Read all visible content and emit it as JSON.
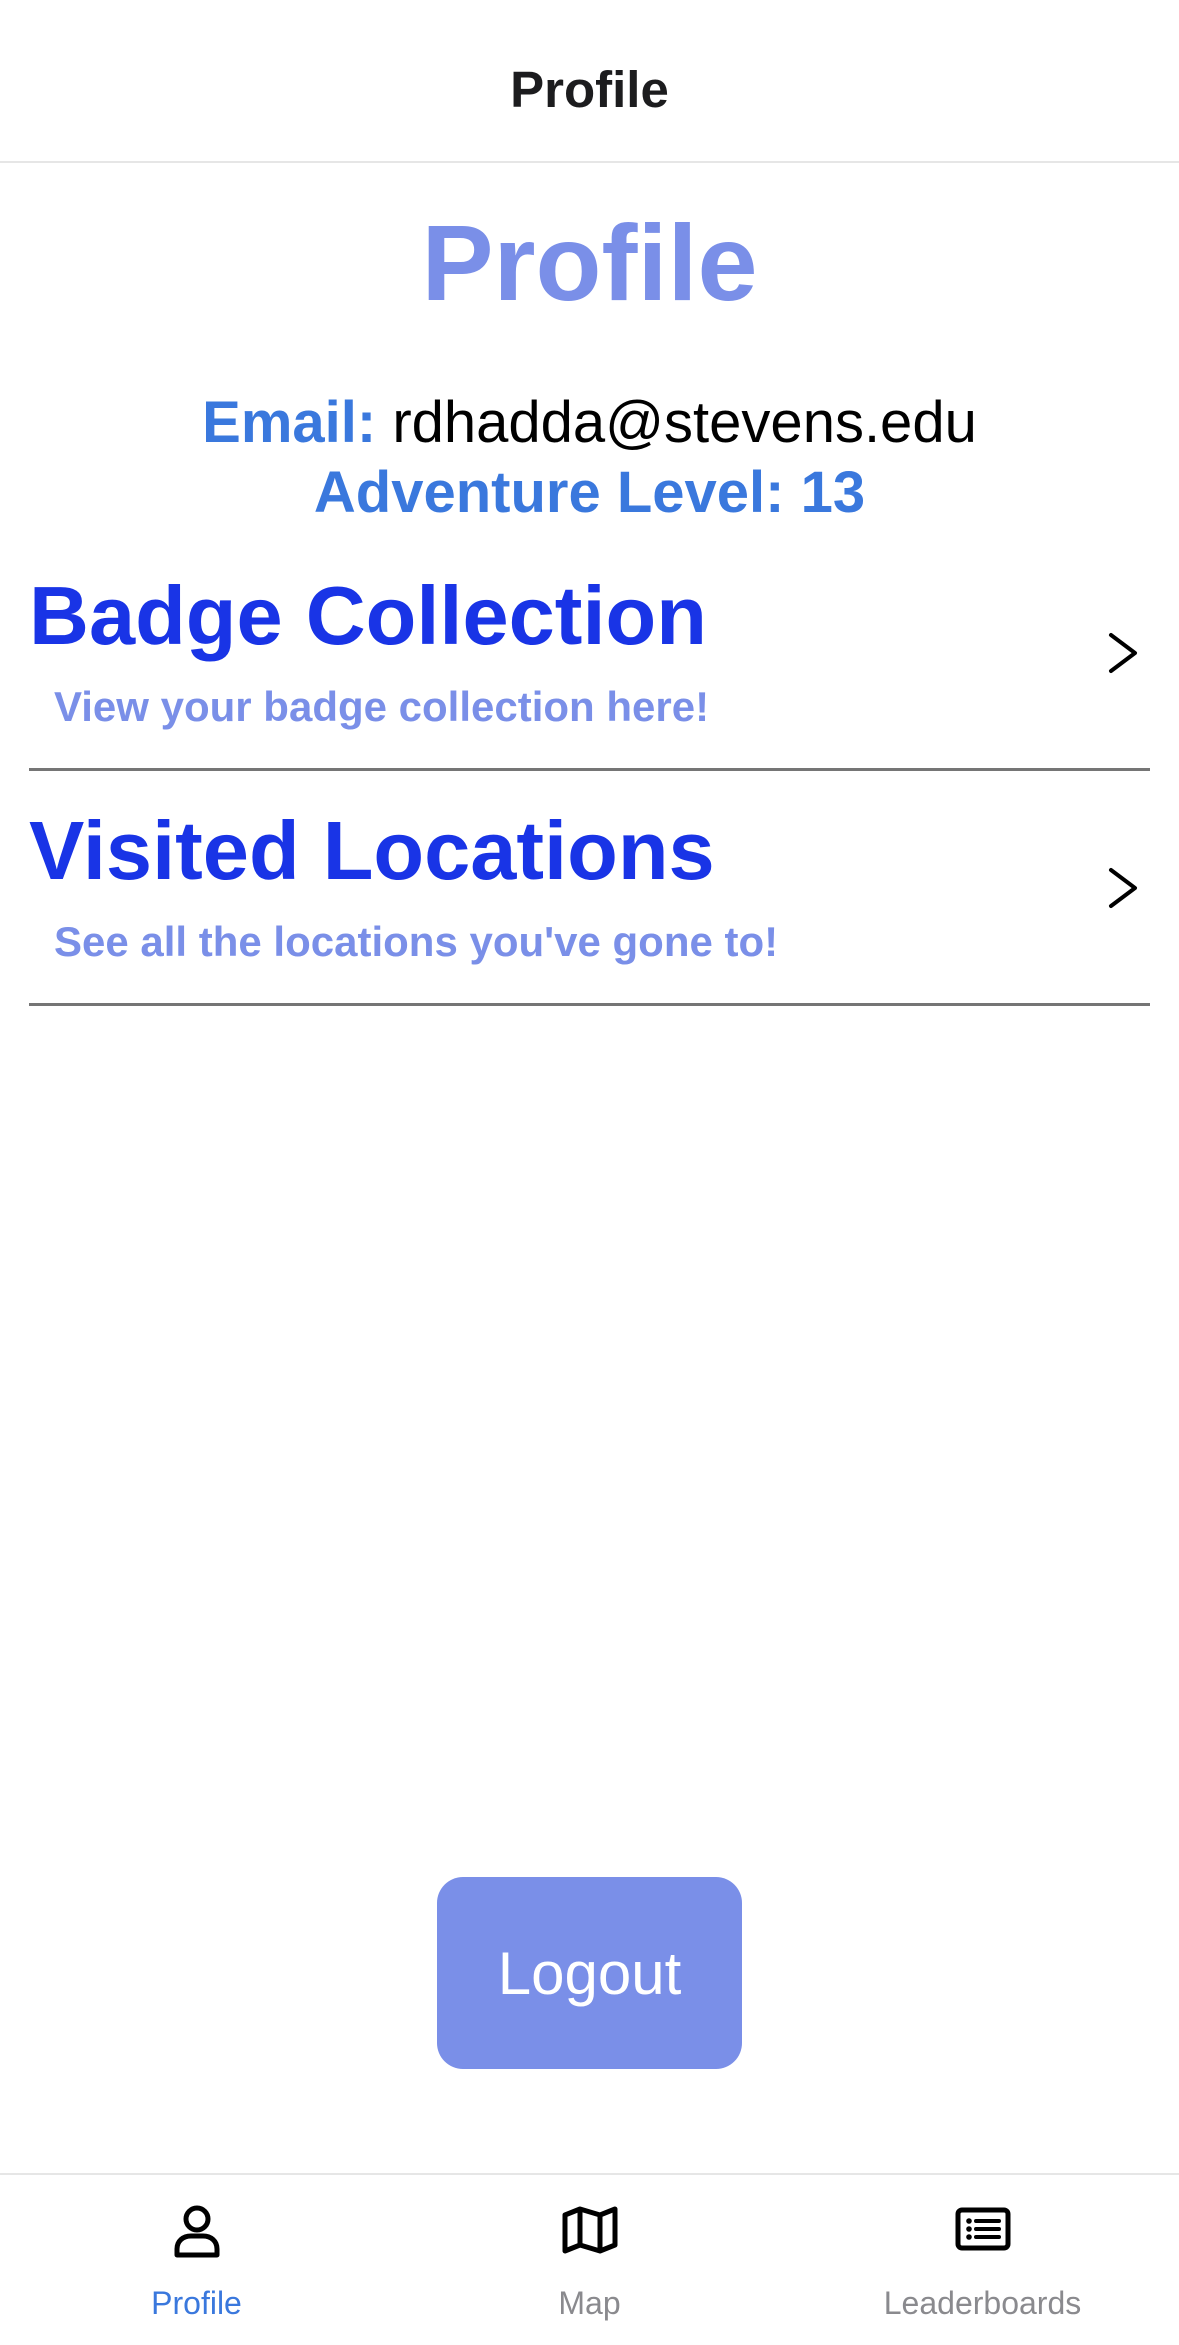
{
  "header": {
    "title": "Profile"
  },
  "profile": {
    "heading": "Profile",
    "email_label": "Email:",
    "email_value": "rdhadda@stevens.edu",
    "level_label": "Adventure Level:",
    "level_value": "13"
  },
  "menu": [
    {
      "title": "Badge Collection",
      "subtitle": "View your badge collection here!",
      "icon": "chevron-right-icon"
    },
    {
      "title": "Visited Locations",
      "subtitle": "See all the locations you've gone to!",
      "icon": "chevron-right-icon"
    }
  ],
  "logout": {
    "label": "Logout"
  },
  "tab_bar": {
    "active": "Profile",
    "tabs": [
      {
        "label": "Profile",
        "icon": "person-icon"
      },
      {
        "label": "Map",
        "icon": "map-icon"
      },
      {
        "label": "Leaderboards",
        "icon": "list-icon"
      }
    ]
  },
  "colors": {
    "accent": "#7a8fe8",
    "label_blue": "#3a78dd",
    "title_blue": "#1934e6",
    "divider": "#757575",
    "inactive_tab": "#8a8a8e"
  }
}
